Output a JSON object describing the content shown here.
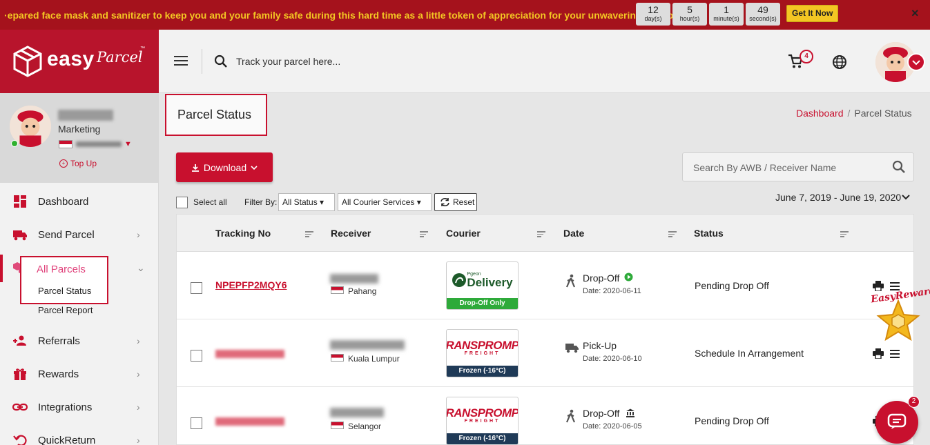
{
  "promo": {
    "text": "·epared face mask and sanitizer to keep you and your family safe during this hard time as a little token of appreciation for your unwavering support.",
    "countdown": [
      {
        "value": "12",
        "unit": "day(s)"
      },
      {
        "value": "5",
        "unit": "hour(s)"
      },
      {
        "value": "1",
        "unit": "minute(s)"
      },
      {
        "value": "49",
        "unit": "second(s)"
      }
    ],
    "cta": "Get It Now",
    "close": "×"
  },
  "brand": {
    "name_part1": "easy",
    "name_part2": "Parcel",
    "tm": "™",
    "color": "#c8102e"
  },
  "header": {
    "search_placeholder": "Track your parcel here...",
    "cart_count": "4"
  },
  "profile": {
    "role": "Marketing",
    "topup": "Top Up"
  },
  "nav": {
    "dashboard": "Dashboard",
    "send_parcel": "Send Parcel",
    "all_parcels": "All Parcels",
    "parcel_status": "Parcel Status",
    "parcel_report": "Parcel Report",
    "referrals": "Referrals",
    "rewards": "Rewards",
    "integrations": "Integrations",
    "quickreturn": "QuickReturn"
  },
  "page": {
    "title": "Parcel Status",
    "breadcrumb": {
      "home": "Dashboard",
      "sep": "/",
      "current": "Parcel Status"
    }
  },
  "toolbar": {
    "download": "Download",
    "search_placeholder": "Search By AWB / Receiver Name",
    "select_all": "Select all",
    "filter_by": "Filter By:",
    "status_filter": "All Status",
    "courier_filter": "All Courier Services",
    "reset": "Reset",
    "date_range": "June 7, 2019 - June 19, 2020"
  },
  "table": {
    "columns": [
      "Tracking No",
      "Receiver",
      "Courier",
      "Date",
      "Status"
    ],
    "rows": [
      {
        "tracking": "NPEPFP2MQY6",
        "state": "Pahang",
        "courier_logo": "Delivery",
        "courier_brand": "Pgeon",
        "courier_tag": "Drop-Off Only",
        "tag_color": "#2eaa3a",
        "date_type": "Drop-Off",
        "date": "Date: 2020-06-11",
        "status": "Pending Drop Off"
      },
      {
        "tracking": "",
        "state": "Kuala Lumpur",
        "courier_logo": "TRANSPROMPT",
        "courier_sub": "FREIGHT",
        "courier_tag": "Frozen (-16°C)",
        "tag_color": "#1f3a57",
        "date_type": "Pick-Up",
        "date": "Date: 2020-06-10",
        "status": "Schedule In Arrangement"
      },
      {
        "tracking": "",
        "state": "Selangor",
        "courier_logo": "TRANSPROMPT",
        "courier_sub": "FREIGHT",
        "courier_tag": "Frozen (-16°C)",
        "tag_color": "#1f3a57",
        "date_type": "Drop-Off",
        "date": "Date: 2020-06-05",
        "status": "Pending Drop Off"
      }
    ]
  },
  "floating": {
    "reward_label": "EasyReward",
    "chat_badge": "2"
  }
}
